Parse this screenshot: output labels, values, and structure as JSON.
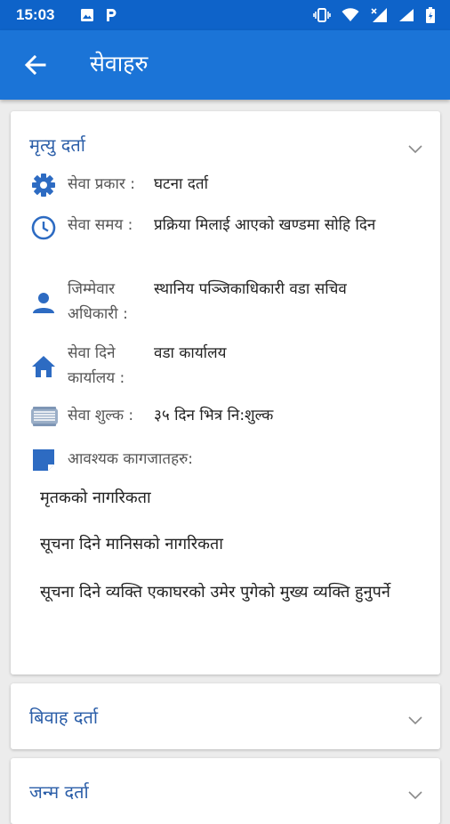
{
  "status_bar": {
    "time": "15:03",
    "left_icons": [
      "image-icon",
      "parking-icon"
    ],
    "right_icons": [
      "vibrate-icon",
      "wifi-icon",
      "signal-icon",
      "signal-icon",
      "battery-icon"
    ]
  },
  "app_bar": {
    "title": "सेवाहरु",
    "back_icon": "arrow-back-icon"
  },
  "colors": {
    "status_bar": "#0e63c9",
    "app_bar": "#1b74d7",
    "accent": "#2d6bc2",
    "title_text": "#2b5ea8"
  },
  "services": [
    {
      "title": "मृत्यु दर्ता",
      "expanded": true,
      "details": [
        {
          "icon": "gear-icon",
          "label": "सेवा प्रकार :",
          "value": "घटना दर्ता"
        },
        {
          "icon": "clock-icon",
          "label": "सेवा समय :",
          "value": "प्रक्रिया मिलाई आएको खण्डमा सोहि दिन"
        },
        {
          "icon": "person-icon",
          "label": "जिम्मेवार अधिकारी :",
          "value": "स्थानिय पञ्जिकाधिकारी वडा सचिव"
        },
        {
          "icon": "home-icon",
          "label": "सेवा दिने कार्यालय :",
          "value": "वडा कार्यालय"
        },
        {
          "icon": "money-icon",
          "label": "सेवा शुल्क :",
          "value": "३५ दिन भित्र नि:शुल्क"
        }
      ],
      "documents_label": "आवश्यक कागजातहरु:",
      "documents": [
        "मृतकको नागरिकता",
        "सूचना दिने मानिसको नागरिकता",
        "सूचना दिने व्यक्ति एकाघरको उमेर पुगेको मुख्य व्यक्ति हुनुपर्ने"
      ]
    },
    {
      "title": "बिवाह दर्ता",
      "expanded": false
    },
    {
      "title": "जन्म दर्ता",
      "expanded": false
    }
  ]
}
